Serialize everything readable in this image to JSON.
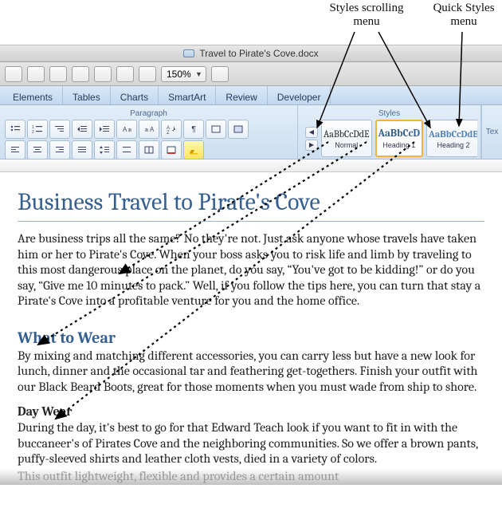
{
  "annotations": {
    "styles_scroll_label": "Styles scrolling\nmenu",
    "quick_styles_label": "Quick Styles\nmenu"
  },
  "window": {
    "title": "Travel to Pirate's Cove.docx"
  },
  "toolbar": {
    "zoom_value": "150%"
  },
  "tabs": {
    "items": [
      "Elements",
      "Tables",
      "Charts",
      "SmartArt",
      "Review",
      "Developer"
    ]
  },
  "ribbon": {
    "paragraph_label": "Paragraph",
    "styles_label": "Styles",
    "text_label": "Tex",
    "style_gallery": [
      {
        "sample": "AaBbCcDdE",
        "name": "Normal",
        "cls": ""
      },
      {
        "sample": "AaBbCcD",
        "name": "Heading 1",
        "cls": "h1"
      },
      {
        "sample": "AaBbCcDdE",
        "name": "Heading 2",
        "cls": "h2"
      }
    ]
  },
  "document": {
    "title": "Business Travel to Pirate's Cove",
    "intro": "Are business trips all the same? No they're not. Just ask anyone whose travels have taken him or her to Pirate's Cove. When your boss asks you to risk life and limb by traveling to this most dangerous place on the planet, do you say, “You've got to be kidding!” or do you say, “Give me 10 minutes to pack.” Well, if you follow the tips here, you can turn that stay a Pirate's Cove into a profitable venture for you and the home office.",
    "h1_1": "What to Wear",
    "p_h1_1": "By mixing and matching different accessories, you can carry less but have a new look for lunch, dinner and the occasional tar and feathering get-togethers. Finish your outfit with our Black Beard Boots, great for those moments when you must wade from ship to shore.",
    "h2_1": "Day Wear",
    "p_h2_1": "During the day, it's best to go for that Edward Teach look if you want to fit in with the buccaneer's of Pirates Cove and the neighboring communities. So we offer a brown pants, puffy-sleeved shirts and leather cloth vests, died in a variety of colors.",
    "cutoff": "This outfit lightweight, flexible and provides a certain amount"
  }
}
